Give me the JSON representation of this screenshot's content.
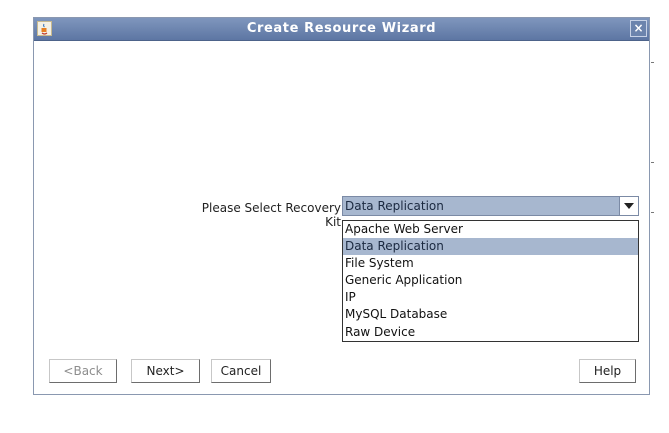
{
  "window": {
    "title": "Create Resource Wizard",
    "close_symbol": "×"
  },
  "form": {
    "label": "Please Select Recovery Kit",
    "selected": "Data Replication",
    "options": [
      "Apache Web Server",
      "Data Replication",
      "File System",
      "Generic Application",
      "IP",
      "MySQL Database",
      "Raw Device"
    ]
  },
  "buttons": {
    "back": "<Back",
    "next": "Next>",
    "cancel": "Cancel",
    "help": "Help"
  },
  "colors": {
    "titlebar": "#6a82ad",
    "selection": "#a7b7cf"
  }
}
